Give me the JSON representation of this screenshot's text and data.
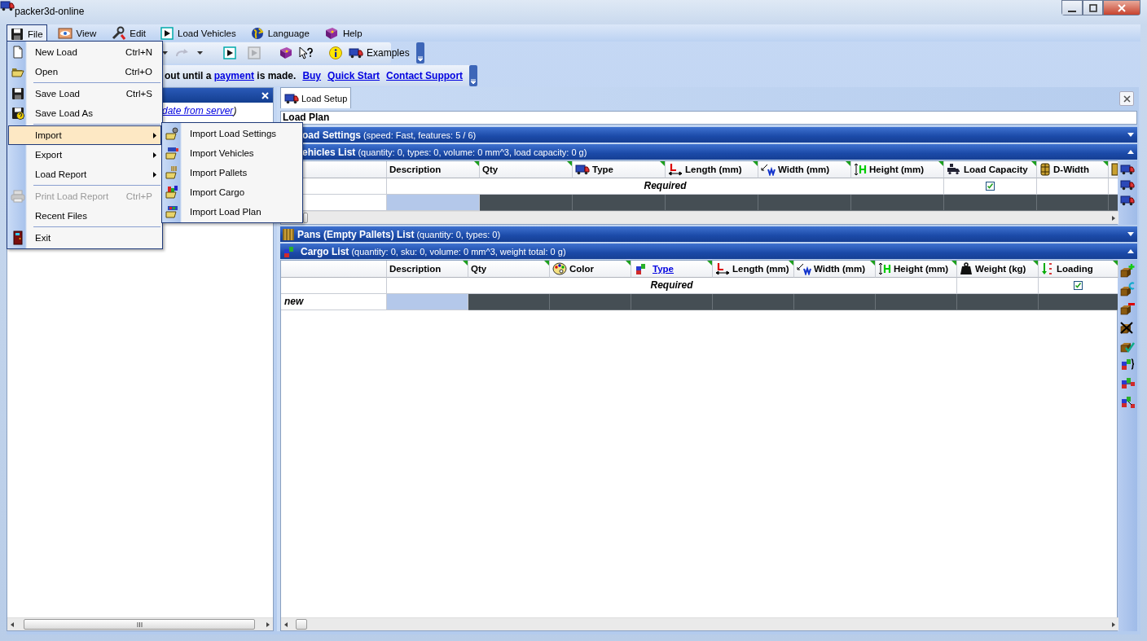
{
  "window": {
    "title": "packer3d-online"
  },
  "menu_bar": [
    {
      "label": "File",
      "selected": true
    },
    {
      "label": "View",
      "selected": false
    },
    {
      "label": "Edit",
      "selected": false
    },
    {
      "label": "Load Vehicles",
      "selected": false
    },
    {
      "label": "Language",
      "selected": false
    },
    {
      "label": "Help",
      "selected": false
    }
  ],
  "toolbar": {
    "items": [
      {
        "kind": "dropdown",
        "disabled": false
      },
      {
        "kind": "redo",
        "disabled": true
      },
      {
        "kind": "dropdown",
        "disabled": false
      },
      {
        "kind": "separator"
      },
      {
        "kind": "run",
        "disabled": false
      },
      {
        "kind": "step",
        "disabled": true
      },
      {
        "kind": "separator"
      },
      {
        "kind": "manual",
        "disabled": false
      },
      {
        "kind": "whats-this",
        "disabled": false
      },
      {
        "kind": "separator"
      },
      {
        "kind": "about",
        "disabled": false
      },
      {
        "kind": "examples",
        "label": "Examples",
        "disabled": false
      }
    ]
  },
  "info_bar": {
    "text_before": "out until a",
    "link": "payment",
    "text_after": "is made.",
    "links": [
      "Buy",
      "Quick Start",
      "Contact Support"
    ]
  },
  "left_panel": {
    "status_link": "date from server",
    "status_after": ")"
  },
  "tabs": [
    {
      "label": "Load Setup",
      "selected": true
    }
  ],
  "load_plan": "Load Plan",
  "sections": [
    {
      "kind": "settings",
      "title": "oad Settings",
      "summary": "(speed: Fast, features: 5 / 6)",
      "expanded": false
    },
    {
      "kind": "vehicles",
      "title": "ehicles List",
      "summary": "(quantity: 0, types: 0, volume: 0 mm^3, load capacity: 0 g)",
      "expanded": true,
      "table": {
        "columns": [
          {
            "kind": "plain",
            "label": "Description"
          },
          {
            "kind": "plain",
            "label": "Qty"
          },
          {
            "kind": "truck",
            "label": "Type"
          },
          {
            "kind": "length",
            "label": "Length (mm)"
          },
          {
            "kind": "width",
            "label": "Width (mm)"
          },
          {
            "kind": "height",
            "label": "Height (mm)"
          },
          {
            "kind": "capacity",
            "label": "Load Capacity"
          },
          {
            "kind": "dwidth",
            "label": "D-Width"
          },
          {
            "kind": "partial"
          }
        ],
        "rows": [
          {
            "kind": "required",
            "label": "Required",
            "cells": [
              {
                "kind": "check",
                "checked": true
              },
              {
                "kind": "blank"
              },
              {
                "kind": "blank"
              }
            ]
          },
          {
            "kind": "new",
            "cells": [
              {
                "selected": true
              },
              {
                "selected": false
              },
              {
                "selected": false
              },
              {
                "selected": false
              },
              {
                "selected": false
              },
              {
                "selected": false
              },
              {
                "selected": false
              },
              {
                "selected": false
              },
              {
                "selected": false
              }
            ]
          }
        ]
      }
    },
    {
      "kind": "pans",
      "title": "Pans (Empty Pallets) List",
      "summary": "(quantity: 0, types: 0)",
      "expanded": false
    },
    {
      "kind": "cargo",
      "title": "Cargo List",
      "summary": "(quantity: 0, sku: 0, volume: 0 mm^3, weight total: 0 g)",
      "expanded": true,
      "table": {
        "columns": [
          {
            "kind": "plain",
            "label": "Description"
          },
          {
            "kind": "plain",
            "label": "Qty"
          },
          {
            "kind": "color",
            "label": "Color"
          },
          {
            "kind": "blocks",
            "label": "Type",
            "link": true
          },
          {
            "kind": "length",
            "label": "Length (mm)"
          },
          {
            "kind": "width",
            "label": "Width (mm)"
          },
          {
            "kind": "height",
            "label": "Height (mm)"
          },
          {
            "kind": "weight",
            "label": "Weight (kg)"
          },
          {
            "kind": "loading",
            "label": "Loading"
          }
        ],
        "rows": [
          {
            "kind": "required",
            "label": "Required",
            "cells": [
              {
                "kind": "blank"
              },
              {
                "kind": "check",
                "checked": true
              }
            ]
          },
          {
            "kind": "new",
            "header": "new",
            "cells": [
              {
                "selected": true
              },
              {
                "selected": false
              },
              {
                "selected": false
              },
              {
                "selected": false
              },
              {
                "selected": false
              },
              {
                "selected": false
              },
              {
                "selected": false
              },
              {
                "selected": false
              },
              {
                "selected": false
              }
            ]
          }
        ]
      }
    }
  ],
  "file_menu": [
    {
      "kind": "item",
      "label": "New Load",
      "shortcut": "Ctrl+N",
      "disabled": false,
      "selected": false
    },
    {
      "kind": "item",
      "label": "Open",
      "shortcut": "Ctrl+O",
      "disabled": false,
      "selected": false
    },
    {
      "kind": "separator"
    },
    {
      "kind": "item",
      "label": "Save Load",
      "shortcut": "Ctrl+S",
      "disabled": false,
      "selected": false
    },
    {
      "kind": "item",
      "label": "Save Load As",
      "disabled": false,
      "selected": false
    },
    {
      "kind": "separator"
    },
    {
      "kind": "submenu",
      "label": "Import",
      "disabled": false,
      "selected": true
    },
    {
      "kind": "submenu",
      "label": "Export",
      "disabled": false,
      "selected": false
    },
    {
      "kind": "submenu",
      "label": "Load Report",
      "disabled": false,
      "selected": false
    },
    {
      "kind": "separator"
    },
    {
      "kind": "item",
      "label": "Print Load Report",
      "shortcut": "Ctrl+P",
      "disabled": true,
      "selected": false
    },
    {
      "kind": "item",
      "label": "Recent Files",
      "disabled": false,
      "selected": false
    },
    {
      "kind": "separator"
    },
    {
      "kind": "item",
      "label": "Exit",
      "disabled": false,
      "selected": false
    }
  ],
  "import_submenu": [
    {
      "label": "Import Load Settings"
    },
    {
      "label": "Import Vehicles"
    },
    {
      "label": "Import Pallets"
    },
    {
      "label": "Import Cargo"
    },
    {
      "label": "Import Load Plan"
    }
  ]
}
